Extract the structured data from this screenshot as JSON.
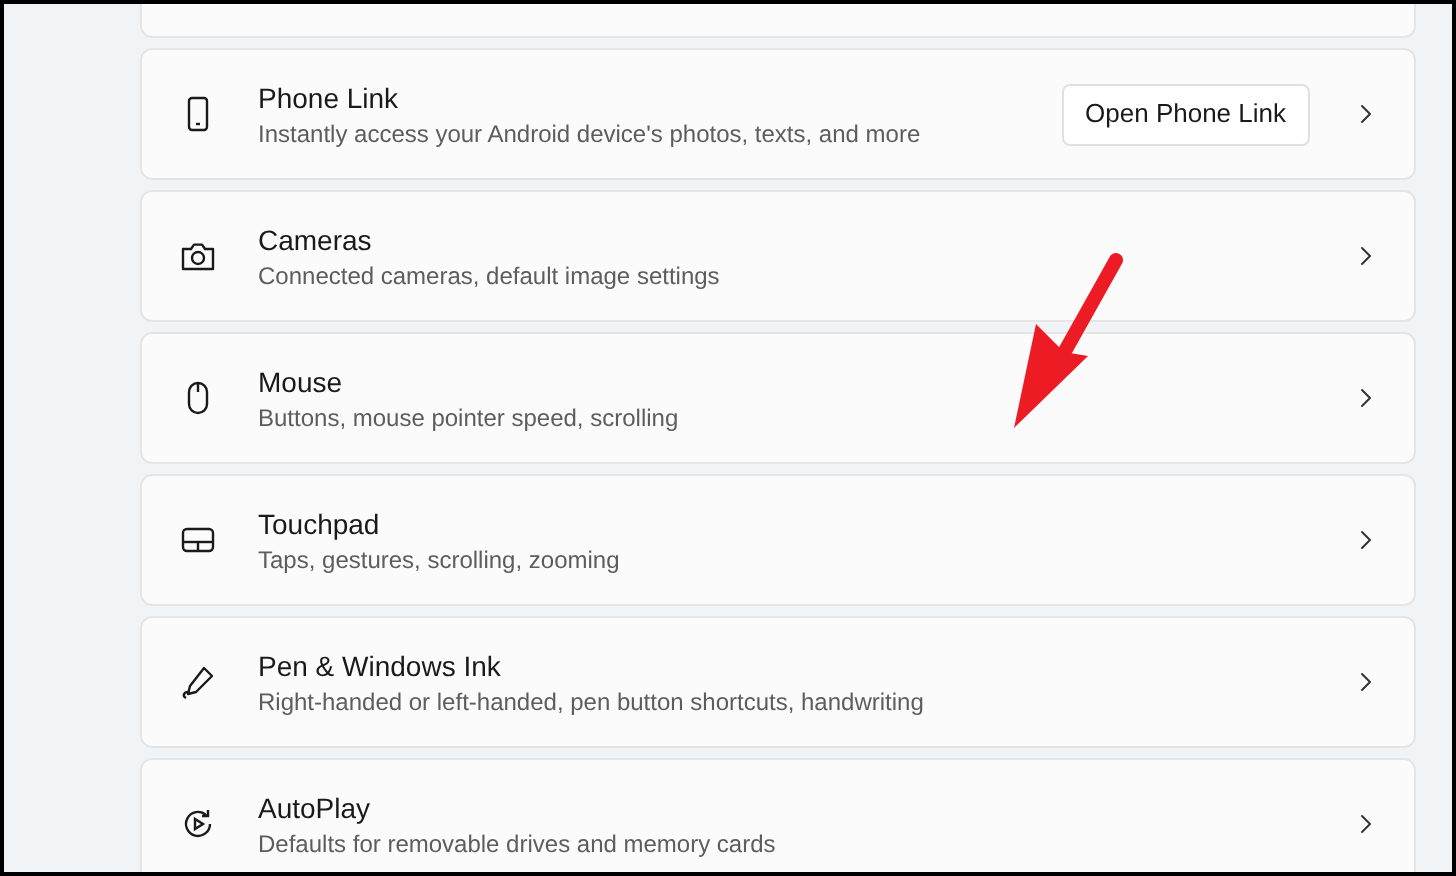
{
  "items": [
    {
      "title": "Phone Link",
      "subtitle": "Instantly access your Android device's photos, texts, and more",
      "button": "Open Phone Link"
    },
    {
      "title": "Cameras",
      "subtitle": "Connected cameras, default image settings"
    },
    {
      "title": "Mouse",
      "subtitle": "Buttons, mouse pointer speed, scrolling"
    },
    {
      "title": "Touchpad",
      "subtitle": "Taps, gestures, scrolling, zooming"
    },
    {
      "title": "Pen & Windows Ink",
      "subtitle": "Right-handed or left-handed, pen button shortcuts, handwriting"
    },
    {
      "title": "AutoPlay",
      "subtitle": "Defaults for removable drives and memory cards"
    }
  ]
}
